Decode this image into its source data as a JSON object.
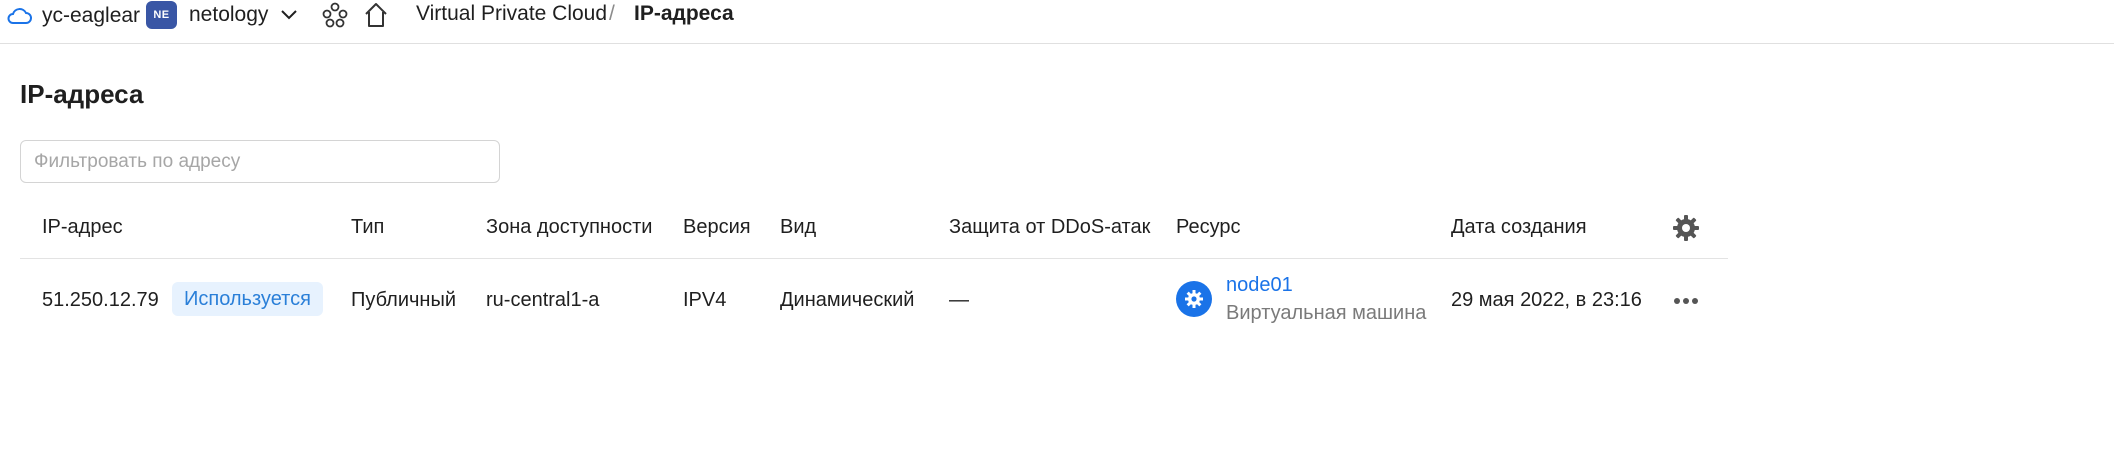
{
  "header": {
    "cloud_name": "yc-eaglear",
    "org_badge": "NE",
    "org_name": "netology",
    "service": "Virtual Private Cloud",
    "separator": "/",
    "current": "IP-адреса"
  },
  "page": {
    "title": "IP-адреса"
  },
  "filter": {
    "placeholder": "Фильтровать по адресу",
    "value": ""
  },
  "table": {
    "columns": [
      "IP-адрес",
      "Тип",
      "Зона доступности",
      "Версия",
      "Вид",
      "Защита от DDoS-атак",
      "Ресурс",
      "Дата создания"
    ],
    "rows": [
      {
        "ip": "51.250.12.79",
        "status": "Используется",
        "type": "Публичный",
        "zone": "ru-central1-a",
        "version": "IPV4",
        "kind": "Динамический",
        "ddos": "—",
        "resource_name": "node01",
        "resource_type": "Виртуальная машина",
        "created": "29 мая 2022, в 23:16"
      }
    ]
  },
  "icons": {
    "cloud": "cloud-icon",
    "chevron": "chevron-down-icon",
    "services": "services-icon",
    "home": "home-icon",
    "settings": "gear-icon",
    "resource": "compute-icon",
    "more": "more-icon"
  },
  "colors": {
    "accent": "#1a73e8",
    "badge_bg": "#e7f2fe",
    "badge_text": "#2a7fd8",
    "org_badge_bg": "#3956a5"
  }
}
